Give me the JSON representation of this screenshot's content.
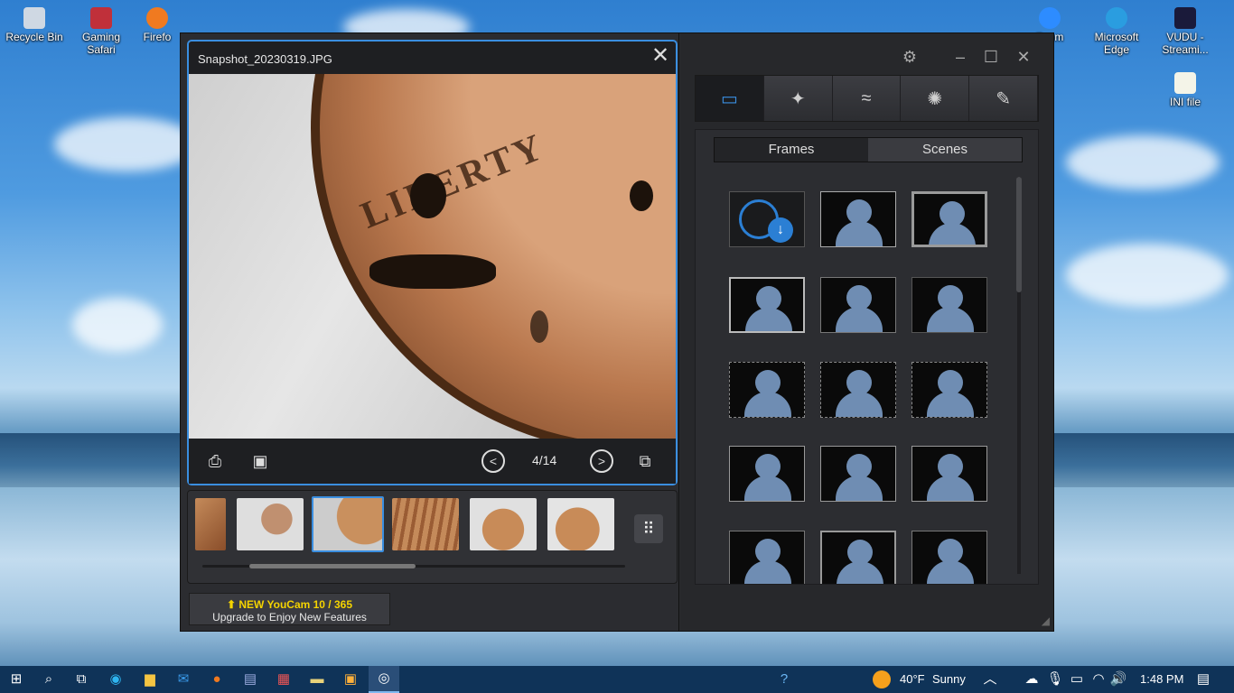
{
  "desktop": {
    "icons": [
      {
        "label": "Recycle Bin"
      },
      {
        "label": "Gaming Safari"
      },
      {
        "label": "Firefo"
      },
      {
        "label": "Microsoft Edge"
      },
      {
        "label": "VUDU - Streami..."
      },
      {
        "label": "INI file"
      },
      {
        "label": "Zoom"
      }
    ]
  },
  "viewer": {
    "filename": "Snapshot_20230319.JPG",
    "photo_text": "LIBERTY",
    "counter": "4/14",
    "prev_glyph": "<",
    "next_glyph": ">"
  },
  "upgrade": {
    "line1": "NEW YouCam 10 / 365",
    "line2": "Upgrade to Enjoy New Features"
  },
  "right_panel": {
    "tabs": [
      "frames-tab",
      "magic-tab",
      "effects-tab",
      "avatar-tab",
      "draw-tab"
    ],
    "active_tab": 0,
    "segments": {
      "frames": "Frames",
      "scenes": "Scenes"
    },
    "active_segment": "Frames"
  },
  "taskbar": {
    "weather_temp": "40°F",
    "weather_cond": "Sunny",
    "time": "1:48 PM"
  },
  "colors": {
    "accent": "#3a8ee0",
    "upgrade_yellow": "#f5d400",
    "taskbar": "#0f3358"
  }
}
